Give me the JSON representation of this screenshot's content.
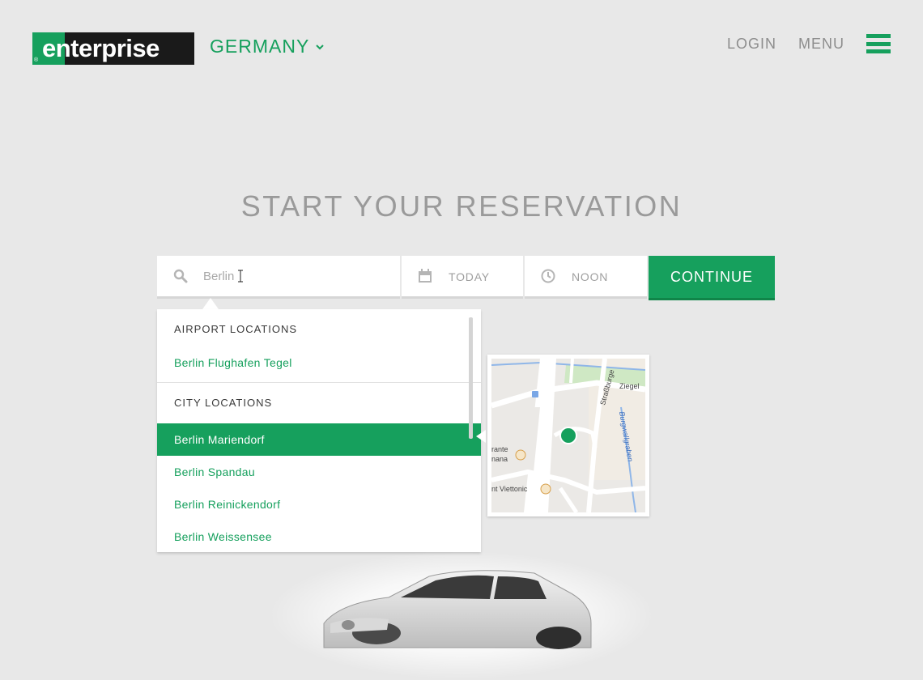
{
  "header": {
    "logo_text": "enterprise",
    "logo_reg": "®",
    "country": "GERMANY",
    "login": "LOGIN",
    "menu": "MENU"
  },
  "hero": {
    "title": "START YOUR RESERVATION"
  },
  "search": {
    "location_value": "Berlin",
    "date_value": "TODAY",
    "time_value": "NOON",
    "continue_label": "CONTINUE"
  },
  "dropdown": {
    "airport_header": "AIRPORT LOCATIONS",
    "airport_items": [
      "Berlin Flughafen Tegel"
    ],
    "city_header": "CITY LOCATIONS",
    "city_items": [
      "Berlin Mariendorf",
      "Berlin Spandau",
      "Berlin Reinickendorf",
      "Berlin Weissensee"
    ],
    "active_item": "Berlin Mariendorf"
  },
  "map": {
    "labels": [
      "Straßburge",
      "Ziegel",
      "Burgwallgraben",
      "rante",
      "nana",
      "nt Viettonic"
    ]
  },
  "colors": {
    "brand_green": "#16a05d",
    "background": "#e8e8e8",
    "muted_text": "#9a9a9a"
  },
  "icons": {
    "search": "search-icon",
    "calendar": "calendar-icon",
    "clock": "clock-icon",
    "menu": "hamburger-menu-icon",
    "chevron": "chevron-down-icon"
  }
}
